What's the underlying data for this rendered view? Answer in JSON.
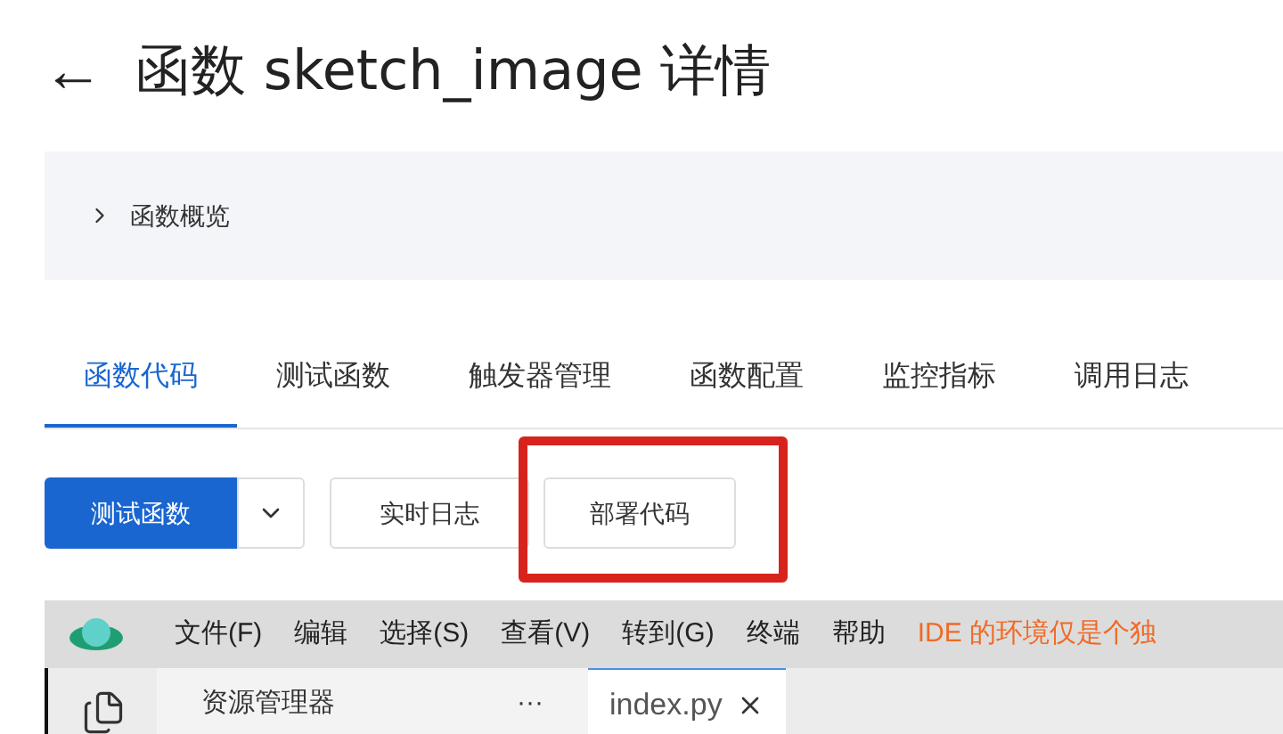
{
  "header": {
    "back": "←",
    "title": "函数 sketch_image 详情"
  },
  "overview": {
    "label": "函数概览",
    "expanded": false
  },
  "tabs": [
    {
      "label": "函数代码",
      "selected": true
    },
    {
      "label": "测试函数",
      "selected": false
    },
    {
      "label": "触发器管理",
      "selected": false
    },
    {
      "label": "函数配置",
      "selected": false
    },
    {
      "label": "监控指标",
      "selected": false
    },
    {
      "label": "调用日志",
      "selected": false
    }
  ],
  "toolbar": {
    "test_button": "测试函数",
    "log_button": "实时日志",
    "deploy_button": "部署代码",
    "deploy_highlighted": true
  },
  "ide": {
    "menu": [
      "文件(F)",
      "编辑",
      "选择(S)",
      "查看(V)",
      "转到(G)",
      "终端",
      "帮助"
    ],
    "notice": "IDE 的环境仅是个独",
    "explorer_title": "资源管理器",
    "explorer_more": "···",
    "editor_tabs": [
      {
        "label": "index.py",
        "selected": true
      }
    ]
  }
}
